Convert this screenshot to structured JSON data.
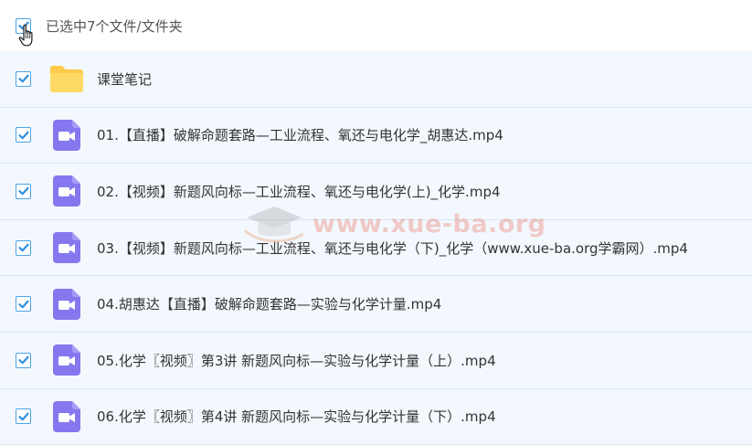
{
  "header": {
    "selection_label": "已选中7个文件/文件夹",
    "checked": true
  },
  "rows": [
    {
      "type": "folder",
      "icon": "folder-icon",
      "name": "课堂笔记",
      "checked": true
    },
    {
      "type": "video",
      "icon": "video-file-icon",
      "name": "01.【直播】破解命题套路—工业流程、氧还与电化学_胡惠达.mp4",
      "checked": true
    },
    {
      "type": "video",
      "icon": "video-file-icon",
      "name": "02.【视频】新题风向标—工业流程、氧还与电化学(上)_化学.mp4",
      "checked": true
    },
    {
      "type": "video",
      "icon": "video-file-icon",
      "name": "03.【视频】新题风向标—工业流程、氧还与电化学（下)_化学（www.xue-ba.org学霸网）.mp4",
      "checked": true
    },
    {
      "type": "video",
      "icon": "video-file-icon",
      "name": "04.胡惠达【直播】破解命题套路—实验与化学计量.mp4",
      "checked": true
    },
    {
      "type": "video",
      "icon": "video-file-icon",
      "name": "05.化学〖视频〗第3讲 新题风向标—实验与化学计量（上）.mp4",
      "checked": true
    },
    {
      "type": "video",
      "icon": "video-file-icon",
      "name": "06.化学〖视频〗第4讲 新题风向标—实验与化学计量（下）.mp4",
      "checked": true
    }
  ],
  "watermark": {
    "text": "www.xue-ba.org"
  },
  "colors": {
    "accent": "#3d9ae6",
    "row_bg": "#f3f8fe",
    "folder": "#ffd15c",
    "video_icon": "#8a7cf0"
  }
}
